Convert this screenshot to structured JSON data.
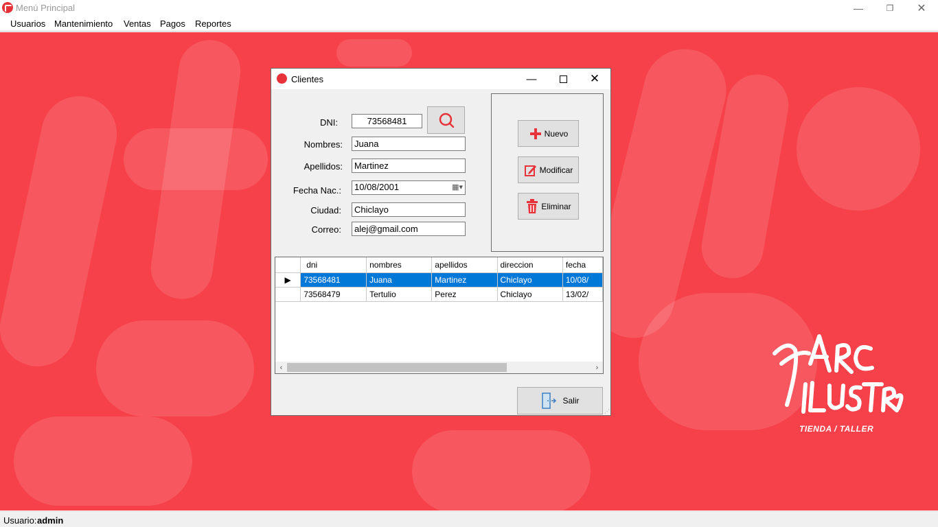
{
  "window": {
    "title": "Menú Principal"
  },
  "menubar": {
    "items": [
      "Usuarios",
      "Mantenimiento",
      "Ventas",
      "Pagos",
      "Reportes"
    ]
  },
  "logo": {
    "tagline": "TIENDA / TALLER"
  },
  "status": {
    "user_label": "Usuario:",
    "user_value": "admin"
  },
  "dialog": {
    "title": "Clientes",
    "fields": {
      "dni_label": "DNI:",
      "dni_value": "73568481",
      "nombres_label": "Nombres:",
      "nombres_value": "Juana",
      "apellidos_label": "Apellidos:",
      "apellidos_value": "Martinez",
      "fecha_label": "Fecha Nac.:",
      "fecha_value": "10/08/2001",
      "ciudad_label": "Ciudad:",
      "ciudad_value": "Chiclayo",
      "correo_label": "Correo:",
      "correo_value": "alej@gmail.com"
    },
    "buttons": {
      "nuevo": "Nuevo",
      "modificar": "Modificar",
      "eliminar": "Eliminar",
      "salir": "Salir"
    },
    "grid": {
      "columns": [
        "dni",
        "nombres",
        "apellidos",
        "direccion",
        "fecha"
      ],
      "rows": [
        [
          "73568481",
          "Juana",
          "Martinez",
          "Chiclayo",
          "10/08/"
        ],
        [
          "73568479",
          "Tertulio",
          "Perez",
          "Chiclayo",
          "13/02/"
        ]
      ]
    }
  },
  "colors": {
    "accent": "#e8323a",
    "background": "#f6414a",
    "selection": "#0078d7"
  }
}
